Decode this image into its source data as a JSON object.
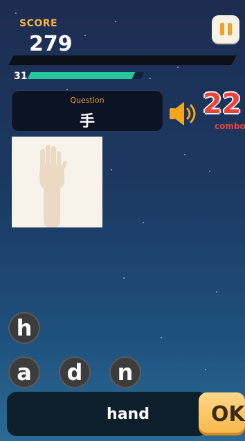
{
  "score": {
    "label": "SCORE",
    "value": "279"
  },
  "timer": {
    "seconds": "31",
    "fill_fraction": 0.92
  },
  "pause_button": {
    "icon": "pause-icon",
    "color": "#f0a12a"
  },
  "question": {
    "label": "Question",
    "text": "手"
  },
  "speaker": {
    "icon": "speaker-icon",
    "color": "#f3a51d"
  },
  "combo": {
    "count": "22",
    "label": "combo"
  },
  "picture": {
    "subject": "hand-image"
  },
  "letter_tiles": [
    {
      "letter": "h"
    },
    {
      "letter": "a"
    },
    {
      "letter": "d"
    },
    {
      "letter": "n"
    }
  ],
  "answer": {
    "text": "hand"
  },
  "ok_button": {
    "label": "OK"
  }
}
